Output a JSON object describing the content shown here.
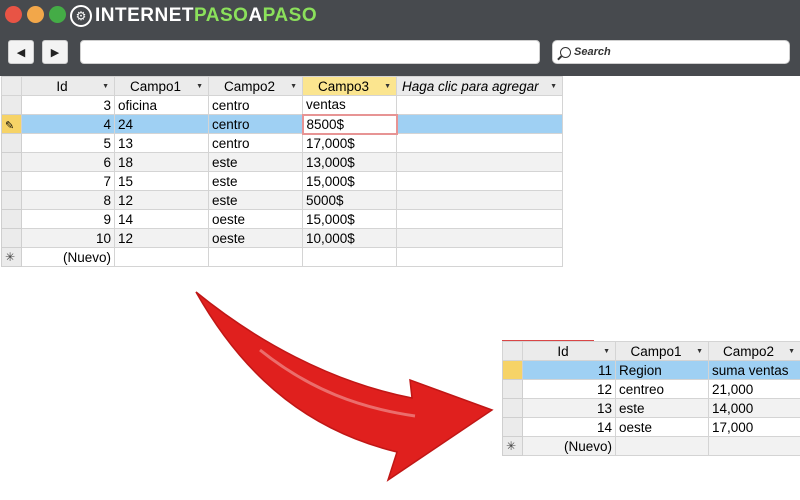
{
  "logo": {
    "part1": "INTERNET",
    "part2": "PASO",
    "part3": "A",
    "part4": "PASO"
  },
  "browser": {
    "back_icon": "◀",
    "forward_icon": "▶",
    "search_placeholder": "Search"
  },
  "table1": {
    "columns": [
      "Id",
      "Campo1",
      "Campo2",
      "Campo3",
      "Haga clic para agregar"
    ],
    "rows": [
      [
        "3",
        "oficina",
        "centro",
        "ventas",
        ""
      ],
      [
        "4",
        "24",
        "centro",
        "8500$",
        ""
      ],
      [
        "5",
        "13",
        "centro",
        "17,000$",
        ""
      ],
      [
        "6",
        "18",
        "este",
        "13,000$",
        ""
      ],
      [
        "7",
        "15",
        "este",
        "15,000$",
        ""
      ],
      [
        "8",
        "12",
        "este",
        "5000$",
        ""
      ],
      [
        "9",
        "14",
        "oeste",
        "15,000$",
        ""
      ],
      [
        "10",
        "12",
        "oeste",
        "10,000$",
        ""
      ]
    ],
    "new_row_label": "(Nuevo)",
    "new_row_icon": "✳",
    "edit_icon": "✎"
  },
  "table2": {
    "columns": [
      "Id",
      "Campo1",
      "Campo2"
    ],
    "rows": [
      [
        "11",
        "Region",
        "suma ventas"
      ],
      [
        "12",
        "centreo",
        "21,000"
      ],
      [
        "13",
        "este",
        "14,000"
      ],
      [
        "14",
        "oeste",
        "17,000"
      ]
    ],
    "new_row_label": "(Nuevo)",
    "new_row_icon": "✳"
  },
  "colors": {
    "arrow": "#e0201e",
    "selection": "#9fd0f3",
    "header_selected": "#fbe58f",
    "logo_accent": "#8be05b"
  }
}
